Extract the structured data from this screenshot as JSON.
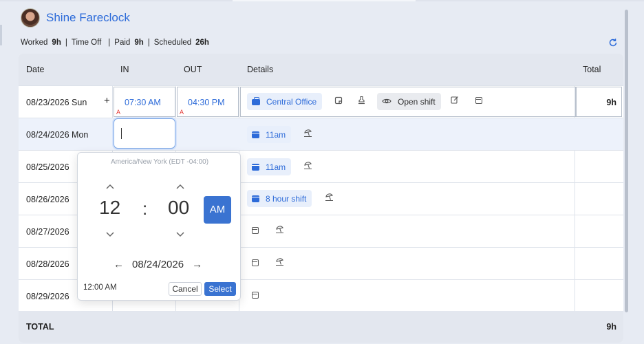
{
  "user": {
    "name": "Shine Fareclock"
  },
  "stats": {
    "worked_label": "Worked",
    "worked_value": "9h",
    "timeoff_label": "Time Off",
    "paid_label": "Paid",
    "paid_value": "9h",
    "scheduled_label": "Scheduled",
    "scheduled_value": "26h",
    "sep": "|"
  },
  "table": {
    "headers": {
      "date": "Date",
      "in": "IN",
      "out": "OUT",
      "details": "Details",
      "total": "Total"
    },
    "rows": [
      {
        "date": "08/23/2026 Sun",
        "add": "+",
        "in": "07:30 AM",
        "out": "04:30 PM",
        "in_flag": "A",
        "out_flag": "A",
        "office": "Central Office",
        "open_shift": "Open shift",
        "total": "9h"
      },
      {
        "date": "08/24/2026 Mon",
        "shift": "11am"
      },
      {
        "date": "08/25/2026",
        "shift": "11am"
      },
      {
        "date": "08/26/2026",
        "shift": "8 hour shift"
      },
      {
        "date": "08/27/2026"
      },
      {
        "date": "08/28/2026"
      },
      {
        "date": "08/29/2026"
      }
    ],
    "footer": {
      "label": "TOTAL",
      "total": "9h"
    }
  },
  "picker": {
    "timezone": "America/New York (EDT -04:00)",
    "hour": "12",
    "colon": ":",
    "minute": "00",
    "ampm": "AM",
    "date": "08/24/2026",
    "prev_arrow": "←",
    "next_arrow": "→",
    "current_time": "12:00 AM",
    "cancel_label": "Cancel",
    "select_label": "Select"
  },
  "icons": {
    "refresh": "refresh-icon",
    "chevron_up": "⌃",
    "chevron_down": "⌄"
  }
}
